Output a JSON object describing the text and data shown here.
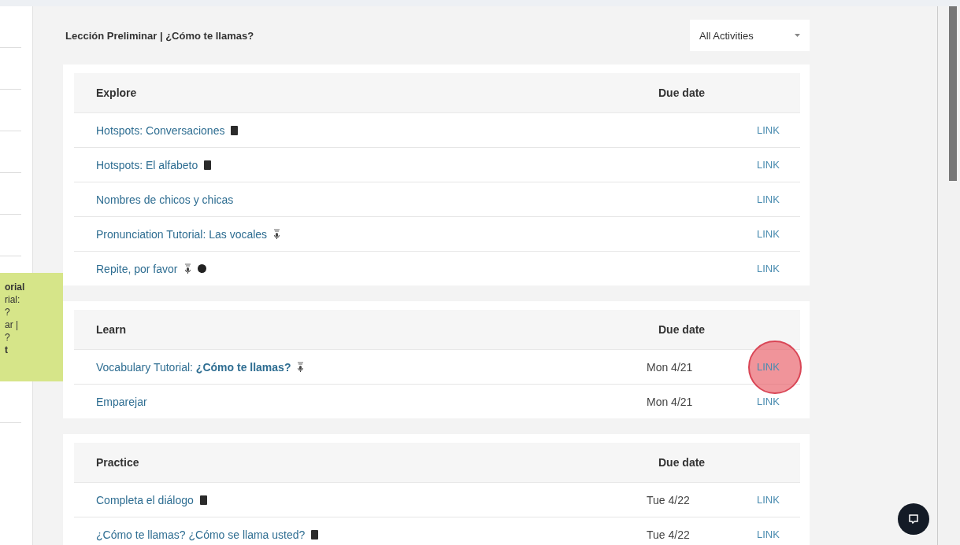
{
  "breadcrumb": "Lección Preliminar | ¿Cómo te llamas?",
  "filter": {
    "value": "All Activities"
  },
  "tooltip": {
    "lines": [
      {
        "text": "orial",
        "bold": true
      },
      {
        "text": "rial:",
        "bold": false
      },
      {
        "text": "?",
        "bold": false
      },
      {
        "text": "ar |",
        "bold": false
      },
      {
        "text": "?",
        "bold": false
      },
      {
        "text": "t",
        "bold": true
      }
    ]
  },
  "sections": [
    {
      "title": "Explore",
      "due_header": "Due date",
      "rows": [
        {
          "title": "Hotspots: Conversaciones",
          "icons": [
            {
              "kind": "tablet"
            }
          ],
          "due": "",
          "link": "LINK",
          "clicked": false
        },
        {
          "title": "Hotspots: El alfabeto",
          "icons": [
            {
              "kind": "tablet"
            }
          ],
          "due": "",
          "link": "LINK",
          "clicked": false
        },
        {
          "title": "Nombres de chicos y chicas",
          "icons": [],
          "due": "",
          "link": "LINK",
          "clicked": false
        },
        {
          "title": "Pronunciation Tutorial: Las vocales",
          "icons": [
            {
              "kind": "microphone"
            }
          ],
          "due": "",
          "link": "LINK",
          "clicked": false
        },
        {
          "title": "Repite, por favor",
          "icons": [
            {
              "kind": "microphone"
            },
            {
              "kind": "circle"
            }
          ],
          "due": "",
          "link": "LINK",
          "clicked": false
        }
      ]
    },
    {
      "title": "Learn",
      "due_header": "Due date",
      "rows": [
        {
          "title": "Vocabulary Tutorial: **¿Cómo te llamas?**",
          "icons": [
            {
              "kind": "microphone"
            }
          ],
          "due": "Mon 4/21",
          "link": "LINK",
          "clicked": true
        },
        {
          "title": "Emparejar",
          "icons": [],
          "due": "Mon 4/21",
          "link": "LINK",
          "clicked": false
        }
      ]
    },
    {
      "title": "Practice",
      "due_header": "Due date",
      "rows": [
        {
          "title": "Completa el diálogo",
          "icons": [
            {
              "kind": "tablet"
            }
          ],
          "due": "Tue 4/22",
          "link": "LINK",
          "clicked": false
        },
        {
          "title": "¿Cómo te llamas? ¿Cómo se llama usted?",
          "icons": [
            {
              "kind": "tablet"
            }
          ],
          "due": "Tue 4/22",
          "link": "LINK",
          "clicked": false
        }
      ]
    }
  ]
}
